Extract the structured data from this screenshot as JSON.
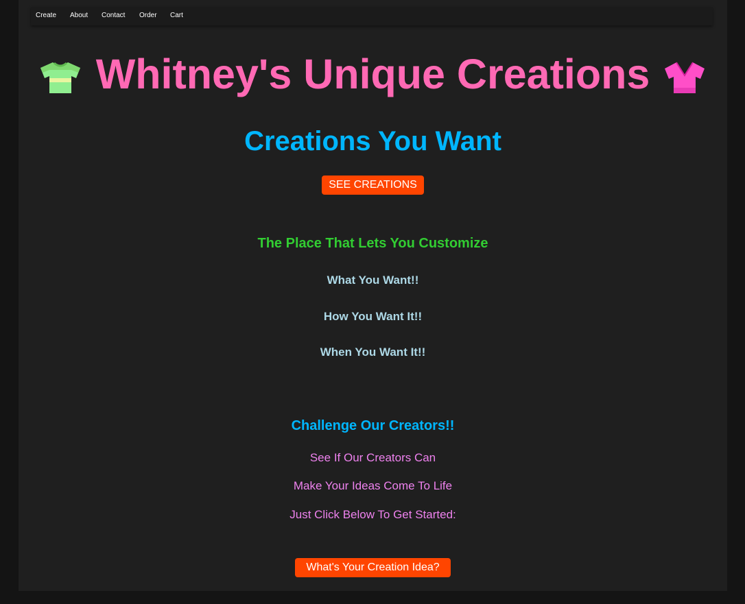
{
  "nav": {
    "items": [
      "Create",
      "About",
      "Contact",
      "Order",
      "Cart"
    ]
  },
  "header": {
    "title": "Whitney's Unique Creations",
    "left_icon": "green-tshirt-icon",
    "right_icon": "pink-blouse-icon"
  },
  "hero": {
    "subtitle": "Creations You Want",
    "button_label": "SEE CREATIONS"
  },
  "features": {
    "tagline": "The Place That Lets You Customize",
    "points": [
      "What You Want!!",
      "How You Want It!!",
      "When You Want It!!"
    ]
  },
  "challenge": {
    "heading": "Challenge Our Creators!!",
    "lines": [
      "See If Our Creators Can",
      "Make Your Ideas Come To Life",
      "Just Click Below To Get Started:"
    ],
    "button_label": "What's Your Creation Idea?"
  },
  "colors": {
    "page_bg": "#141414",
    "panel_bg": "#1f1f1f",
    "title": "#ff69b4",
    "subtitle": "#00b6ff",
    "tagline": "#32cd32",
    "points": "#add8e6",
    "lines": "#ee82ee",
    "button": "#ff4500"
  }
}
